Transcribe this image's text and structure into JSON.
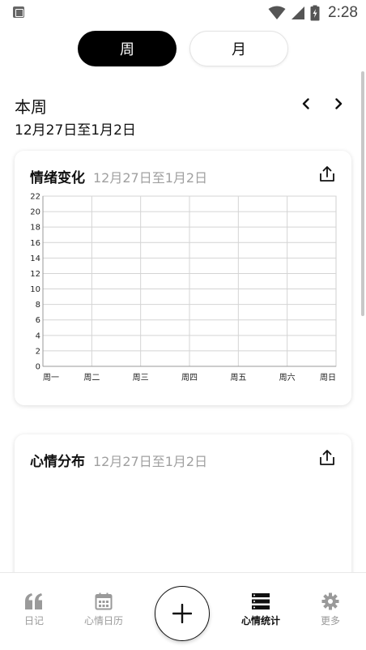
{
  "status_bar": {
    "time": "2:28"
  },
  "segments": {
    "week": "周",
    "month": "月",
    "selected": "week"
  },
  "period": {
    "title": "本周",
    "range": "12月27日至1月2日"
  },
  "mood_change_card": {
    "title": "情绪变化",
    "range": "12月27日至1月2日",
    "share_icon": "share-icon"
  },
  "mood_distribution_card": {
    "title": "心情分布",
    "range": "12月27日至1月2日",
    "share_icon": "share-icon"
  },
  "chart_data": {
    "type": "line",
    "categories": [
      "周一",
      "周二",
      "周三",
      "周四",
      "周五",
      "周六",
      "周日"
    ],
    "series": [],
    "yticks": [
      0,
      2,
      4,
      6,
      8,
      10,
      12,
      14,
      16,
      18,
      20,
      22
    ],
    "ylim": [
      0,
      22
    ],
    "grid": true
  },
  "bottom_nav": {
    "items": [
      {
        "label": "日记",
        "icon": "quote-icon",
        "active": false
      },
      {
        "label": "心情日历",
        "icon": "calendar-icon",
        "active": false
      },
      {
        "label": "心情统计",
        "icon": "stats-icon",
        "active": true
      },
      {
        "label": "更多",
        "icon": "gear-icon",
        "active": false
      }
    ],
    "add_icon": "plus-icon"
  },
  "colors": {
    "accent": "#000000",
    "muted_text": "#a0a0a0",
    "inactive_nav": "#9a9a9a"
  }
}
